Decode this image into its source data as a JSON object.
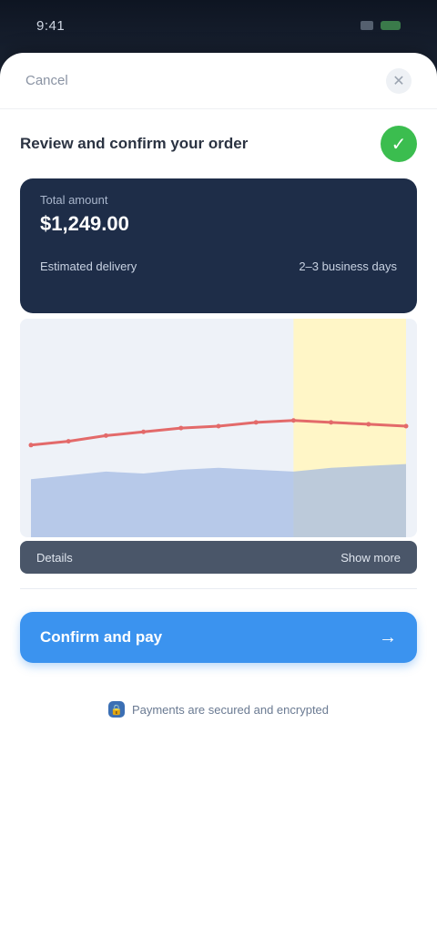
{
  "status_bar": {
    "time": "9:41"
  },
  "sheet": {
    "header_left": "Cancel",
    "close_icon": "close-icon",
    "title": "Review and confirm your order",
    "verified_icon": "check-icon"
  },
  "info_card": {
    "label": "Total amount",
    "value": "$1,249.00",
    "row_left": "Estimated delivery",
    "row_right": "2–3 business days"
  },
  "chart_data": {
    "type": "area",
    "title": "",
    "xlabel": "",
    "ylabel": "",
    "x": [
      0,
      1,
      2,
      3,
      4,
      5,
      6,
      7,
      8,
      9,
      10
    ],
    "series": [
      {
        "values": [
          40,
          42,
          45,
          47,
          49,
          50,
          52,
          53,
          52,
          51,
          50
        ],
        "color": "#e36a6a"
      },
      {
        "values": [
          22,
          24,
          26,
          25,
          27,
          28,
          27,
          26,
          28,
          29,
          30
        ],
        "color": "#9fb8e3"
      }
    ],
    "ylim": [
      0,
      100
    ],
    "highlight": {
      "x_start": 7,
      "x_end": 10,
      "color": "#fff6c7"
    }
  },
  "bar_strip": {
    "left": "Details",
    "right": "Show more"
  },
  "cta": {
    "label": "Confirm and pay",
    "arrow_icon": "arrow-right-icon"
  },
  "secure_note": {
    "lock_icon": "lock-icon",
    "text": "Payments are secured and encrypted"
  },
  "colors": {
    "primary": "#3b93ef",
    "dark_card": "#1e2d48",
    "success": "#3bbd4f"
  }
}
